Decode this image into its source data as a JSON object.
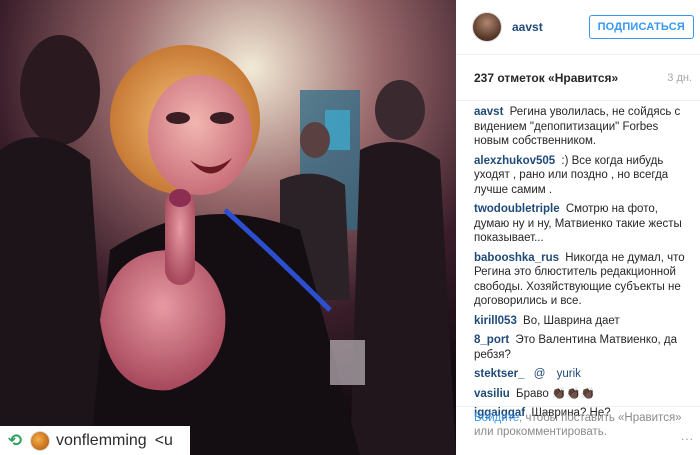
{
  "post": {
    "username": "aavst",
    "follow_label": "ПОДПИСАТЬСЯ",
    "likes": "237 отметок «Нравится»",
    "time_ago": "3 дн."
  },
  "comments": [
    {
      "user": "aavst",
      "text": "Регина уволилась, не сойдясь с видением \"депопитизации\" Forbes новым собственником."
    },
    {
      "user": "alexzhukov505",
      "text": ":) Все когда нибудь уходят , рано или поздно , но всегда лучше самим ."
    },
    {
      "user": "twodoubletriple",
      "text": "Смотрю на фото, думаю ну и ну, Матвиенко такие жесты показывает..."
    },
    {
      "user": "babooshka_rus",
      "text": "Никогда не думал, что Регина это блюститель редакционной свободы. Хозяйствующие субъекты не договорились и все."
    },
    {
      "user": "kirill053",
      "text": "Во, Шаврина дает"
    },
    {
      "user": "8_port",
      "text": "Это Валентина Матвиенко, да ребзя?"
    }
  ],
  "tag_row": {
    "user": "stektser_",
    "mention": "@",
    "tagged": "yurik"
  },
  "comments_tail": [
    {
      "user": "vasiliu",
      "text": "Браво 👏🏿👏🏿👏🏿"
    },
    {
      "user": "iggaiggaf",
      "text": "Шаврина? Не?"
    }
  ],
  "footer": {
    "login_link": "Войдите",
    "rest": ", чтобы поставить «Нравится» или прокомментировать.",
    "more": "..."
  },
  "repost": {
    "user": "vonflemming",
    "suffix": "<u"
  }
}
